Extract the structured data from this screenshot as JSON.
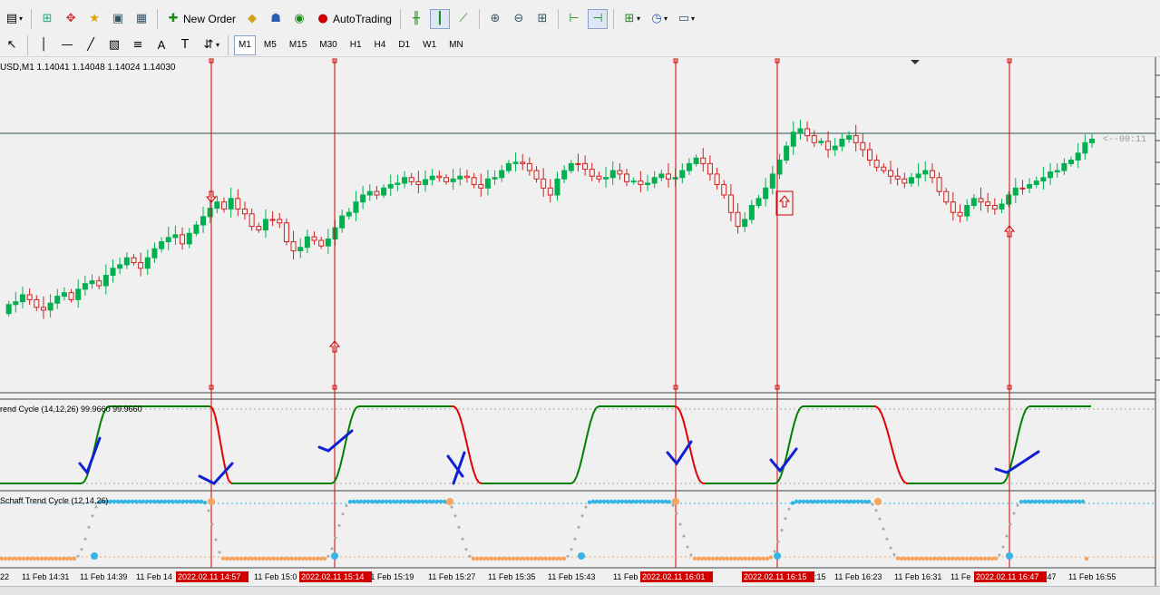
{
  "toolbar": {
    "new_order_label": "New Order",
    "autotrading_label": "AutoTrading",
    "timeframes": [
      "M1",
      "M5",
      "M15",
      "M30",
      "H1",
      "H4",
      "D1",
      "W1",
      "MN"
    ],
    "active_timeframe": "M1"
  },
  "chart": {
    "symbol_info": "USD,M1  1.14041 1.14048 1.14024 1.14030",
    "price_tag": "<--00:11",
    "colors": {
      "bull": "#00b050",
      "bear": "#d22020",
      "vline": "#d00000",
      "stc_up": "#008000",
      "stc_down": "#e00000",
      "dots_top": "#33b5e5",
      "dots_bottom": "#f4a460",
      "dots_mid": "#a9a9a9"
    }
  },
  "indicator1": {
    "label": "rend Cycle (14,12,26) 99.9660 99.9660"
  },
  "indicator2": {
    "label": "Schaff Trend Cycle (12,14,26)"
  },
  "time_axis": {
    "labels": [
      "22",
      "11 Feb 14:31",
      "11 Feb 14:39",
      "11 Feb 14",
      "11 Feb 15:0",
      "11 Feb 15:19",
      "11 Feb 15:27",
      "11 Feb 15:35",
      "11 Feb 15:43",
      "11 Feb 15",
      ":15",
      "11 Feb 16:23",
      "11 Feb 16:31",
      "11 Fe",
      ":47",
      "11 Feb 16:55"
    ],
    "highlighted": [
      "2022.02.11 14:57",
      "2022.02.11 15:14",
      "2022.02.11 16:01",
      "2022.02.11 16:15",
      "2022.02.11 16:47"
    ]
  }
}
